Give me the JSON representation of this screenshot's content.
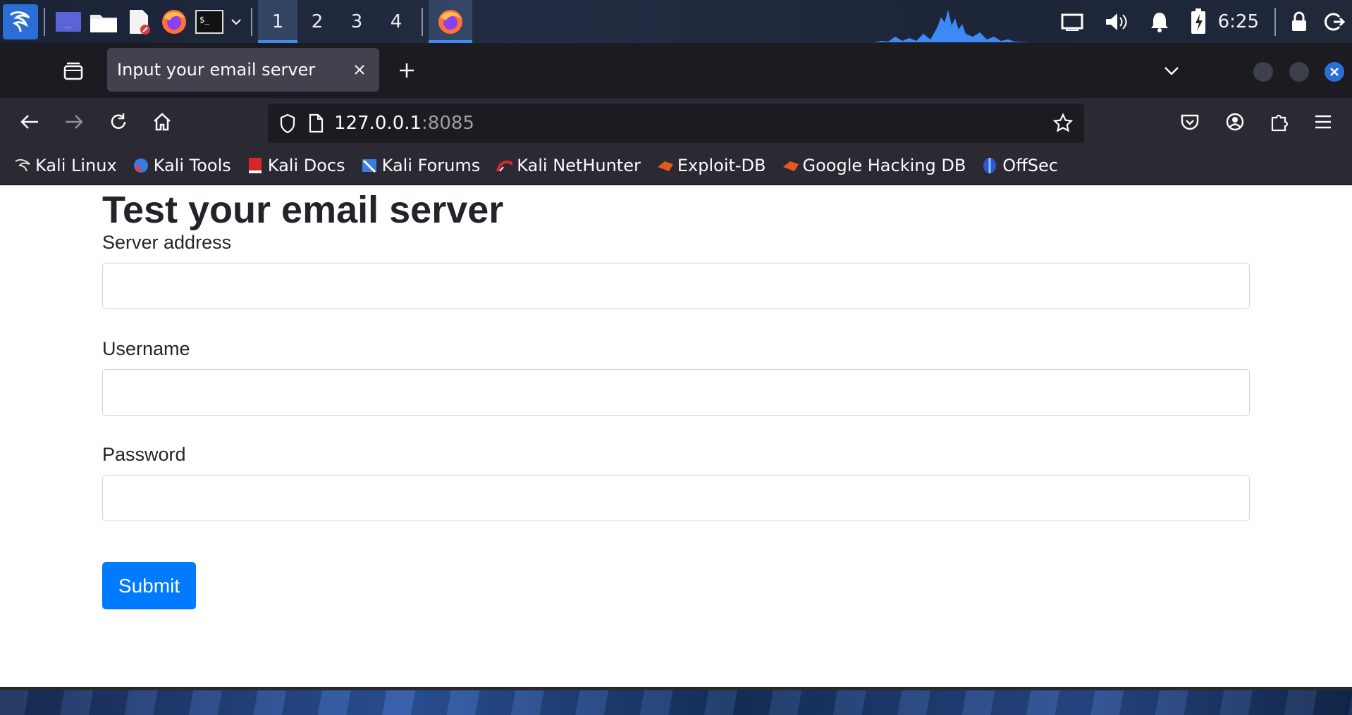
{
  "taskbar": {
    "workspaces": [
      "1",
      "2",
      "3",
      "4"
    ],
    "active_workspace": "1",
    "clock": "6:25"
  },
  "browser": {
    "tab_title": "Input your email server",
    "url_host": "127.0.0.1",
    "url_port": ":8085",
    "bookmarks": [
      {
        "label": "Kali Linux",
        "icon": "kali-dragon-icon"
      },
      {
        "label": "Kali Tools",
        "icon": "kali-tools-icon"
      },
      {
        "label": "Kali Docs",
        "icon": "kali-docs-icon"
      },
      {
        "label": "Kali Forums",
        "icon": "kali-forums-icon"
      },
      {
        "label": "Kali NetHunter",
        "icon": "nethunter-icon"
      },
      {
        "label": "Exploit-DB",
        "icon": "exploit-db-icon"
      },
      {
        "label": "Google Hacking DB",
        "icon": "ghdb-icon"
      },
      {
        "label": "OffSec",
        "icon": "offsec-icon"
      }
    ]
  },
  "page": {
    "title": "Test your email server",
    "fields": [
      {
        "label": "Server address",
        "value": ""
      },
      {
        "label": "Username",
        "value": ""
      },
      {
        "label": "Password",
        "value": ""
      }
    ],
    "submit_label": "Submit"
  },
  "colors": {
    "accent_blue": "#007bff",
    "kali_blue": "#2b6fd6",
    "tabbar_bg": "#1c1b22",
    "toolbar_bg": "#2b2a33"
  }
}
